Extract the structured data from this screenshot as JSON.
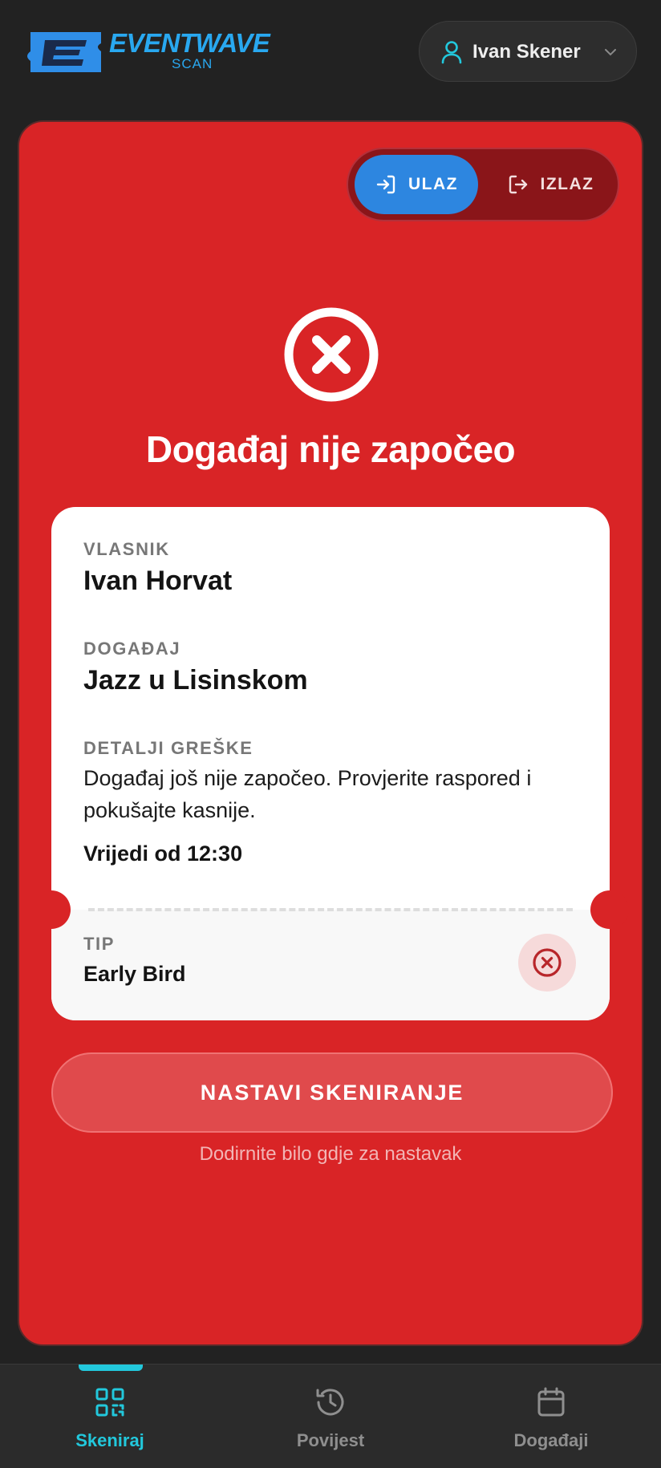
{
  "app": {
    "logo_text": "EVENTWAVE",
    "logo_sub": "SCAN",
    "user_name": "Ivan Skener"
  },
  "mode_toggle": {
    "entry_label": "ULAZ",
    "exit_label": "IZLAZ",
    "active": "entry"
  },
  "result": {
    "status": "error",
    "title": "Događaj nije započeo",
    "owner_label": "VLASNIK",
    "owner_value": "Ivan Horvat",
    "event_label": "DOGAĐAJ",
    "event_value": "Jazz u Lisinskom",
    "error_label": "DETALJI GREŠKE",
    "error_message": "Događaj još nije započeo. Provjerite raspored i pokušajte kasnije.",
    "valid_from": "Vrijedi od 12:30",
    "type_label": "TIP",
    "type_value": "Early Bird"
  },
  "actions": {
    "continue_label": "NASTAVI SKENIRANJE",
    "tap_hint": "Dodirnite bilo gdje za nastavak"
  },
  "nav": {
    "items": [
      {
        "label": "Skeniraj",
        "icon": "qr-code-icon",
        "active": true
      },
      {
        "label": "Povijest",
        "icon": "history-icon",
        "active": false
      },
      {
        "label": "Događaji",
        "icon": "calendar-icon",
        "active": false
      }
    ]
  },
  "colors": {
    "error_red": "#d92426",
    "accent_blue": "#2d86e0",
    "accent_cyan": "#22c8dc",
    "background": "#222222"
  }
}
